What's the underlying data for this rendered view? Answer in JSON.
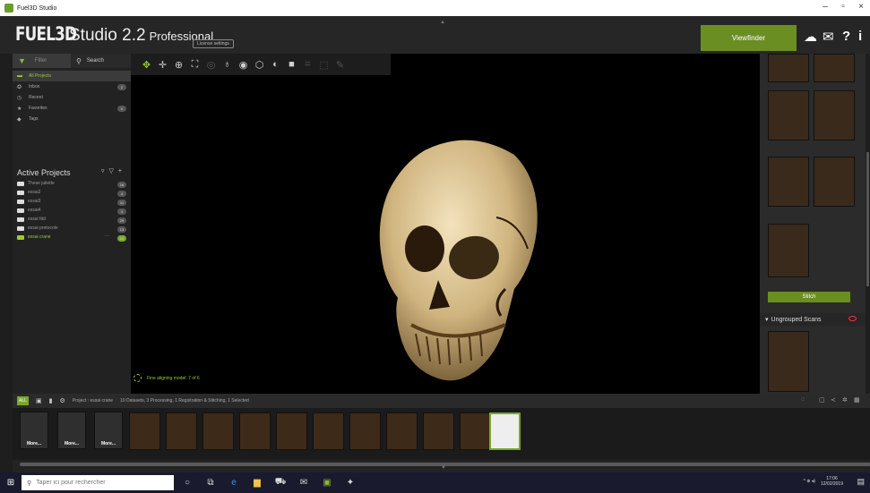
{
  "window": {
    "title": "Fuel3D Studio",
    "controls": {
      "minimize": "–",
      "maximize": "▫",
      "close": "×"
    }
  },
  "header": {
    "logo_brand": "FUEL3D",
    "logo_studio": "Studio 2.2",
    "logo_edition": "Professional",
    "license_label": "License settings",
    "viewfinder_label": "Viewfinder",
    "icons": [
      "cloud-icon",
      "mail-icon",
      "help-icon",
      "info-icon"
    ]
  },
  "left": {
    "filter_label": "Filter",
    "search_label": "Search",
    "nav": [
      {
        "label": "All Projects",
        "badge": "",
        "icon": "folder-icon"
      },
      {
        "label": "Inbox",
        "badge": "2",
        "icon": "inbox-icon"
      },
      {
        "label": "Recent",
        "badge": "",
        "icon": "clock-icon"
      },
      {
        "label": "Favorites",
        "badge": "0",
        "icon": "star-icon"
      },
      {
        "label": "Tags",
        "badge": "",
        "icon": "tag-icon"
      }
    ],
    "active_projects_title": "Active Projects",
    "projects": [
      {
        "label": "These juliette",
        "badge": "16"
      },
      {
        "label": "essai2",
        "badge": "4"
      },
      {
        "label": "essai3",
        "badge": "11"
      },
      {
        "label": "essai4",
        "badge": "3"
      },
      {
        "label": "essai fdd",
        "badge": "29"
      },
      {
        "label": "essai protocole",
        "badge": "13"
      },
      {
        "label": "essai crane",
        "badge": "10",
        "more": "···"
      }
    ]
  },
  "viewport": {
    "status": "Fine aligning model: 7 of 6"
  },
  "right": {
    "stitch_label": "Stitch",
    "ungrouped_label": "Ungrouped Scans"
  },
  "filmbar": {
    "all_label": "ALL",
    "project_label": "Project : essai crane",
    "summary": "10 Datasets, 3 Processing, 1 Registration & Stitching, 1 Selected"
  },
  "filmstrip": {
    "more_label": "More..."
  },
  "taskbar": {
    "search_placeholder": "Taper ici pour rechercher",
    "time": "17:06",
    "date": "12/02/2019"
  }
}
